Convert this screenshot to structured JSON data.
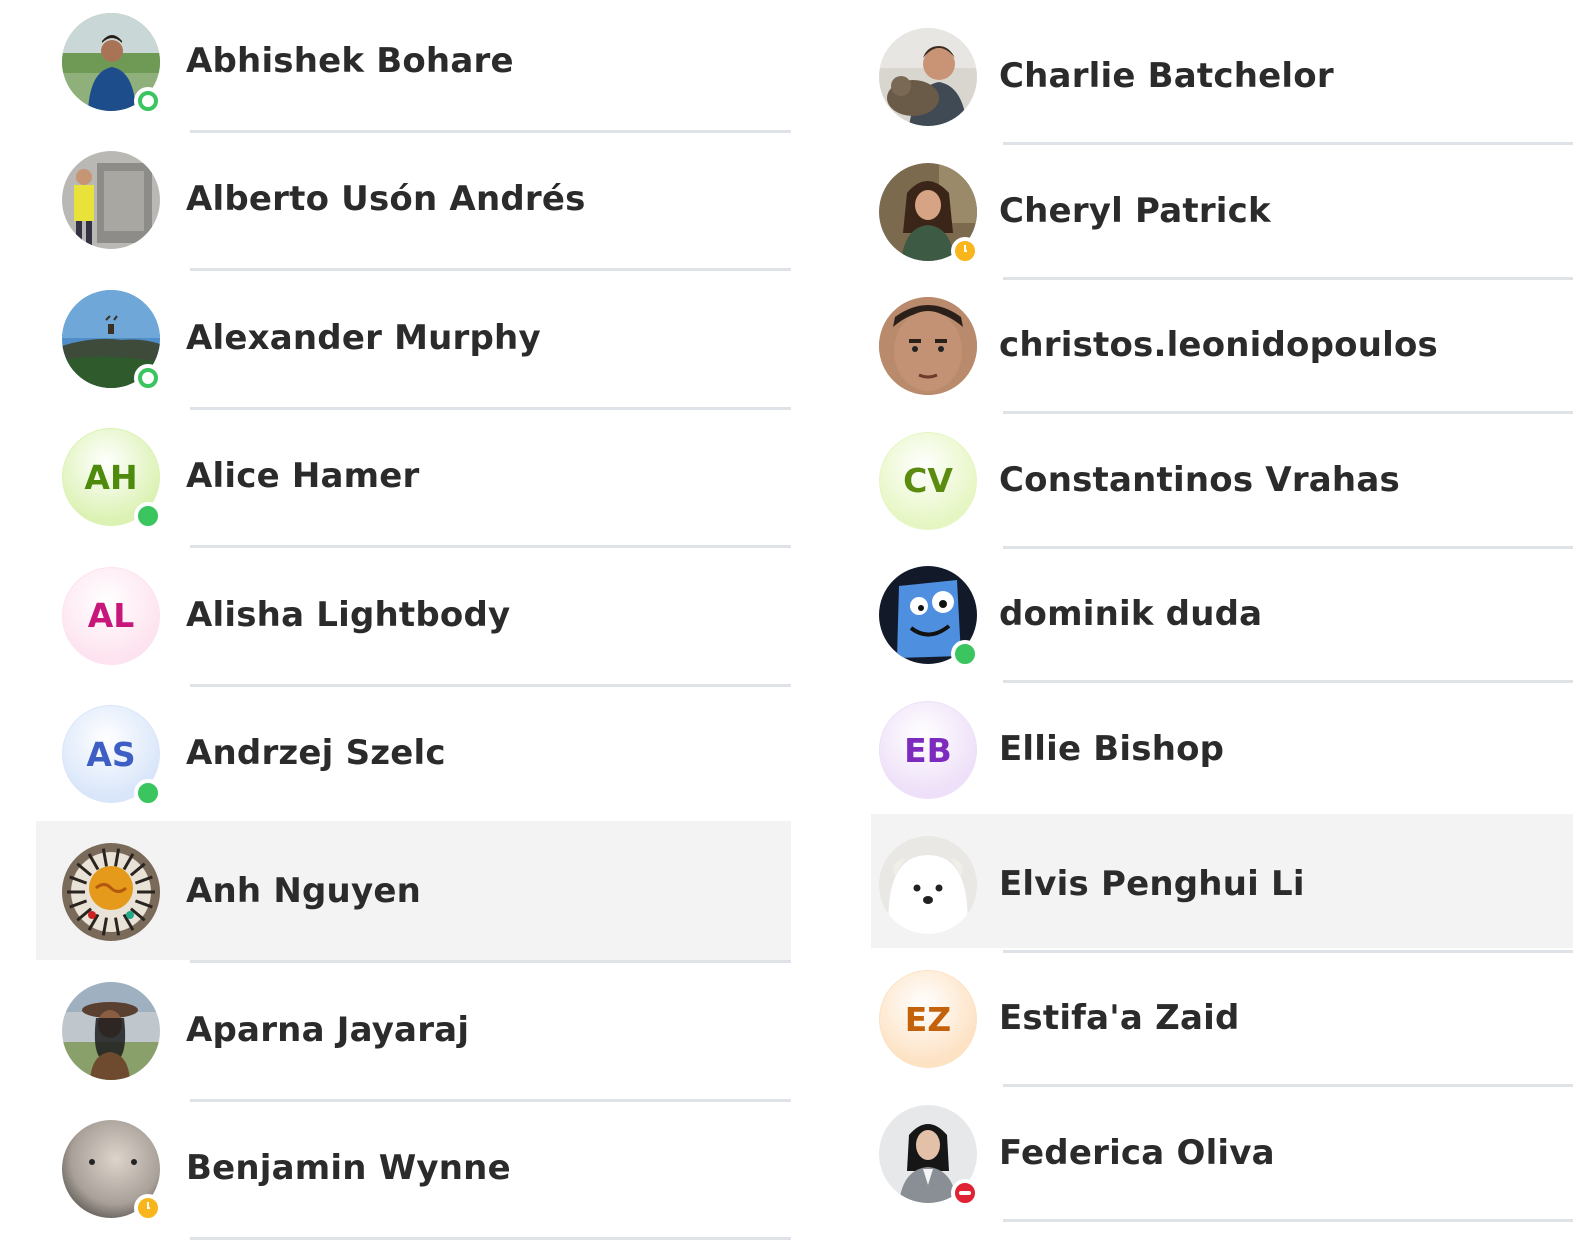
{
  "contacts_left": [
    {
      "name": "Abhishek Bohare",
      "avatar": "photo-man-blue-jacket",
      "status": "online-ring",
      "highlighted": false
    },
    {
      "name": "Alberto Usón Andrés",
      "avatar": "photo-man-with-machine",
      "status": "none",
      "highlighted": false
    },
    {
      "name": "Alexander Murphy",
      "avatar": "photo-deer-landscape",
      "status": "online-ring",
      "highlighted": false
    },
    {
      "name": "Alice Hamer",
      "avatar": "initials",
      "initials": "AH",
      "status": "online",
      "highlighted": false
    },
    {
      "name": "Alisha Lightbody",
      "avatar": "initials",
      "initials": "AL",
      "status": "none",
      "highlighted": false
    },
    {
      "name": "Andrzej Szelc",
      "avatar": "initials",
      "initials": "AS",
      "status": "online",
      "highlighted": false
    },
    {
      "name": "Anh Nguyen",
      "avatar": "photo-food-plate",
      "status": "none",
      "highlighted": true
    },
    {
      "name": "Aparna Jayaraj",
      "avatar": "photo-woman-hat",
      "status": "none",
      "highlighted": false
    },
    {
      "name": "Benjamin Wynne",
      "avatar": "photo-grey-blob",
      "status": "away",
      "highlighted": false
    }
  ],
  "contacts_right": [
    {
      "name": "Charlie Batchelor",
      "avatar": "photo-man-with-cat",
      "status": "none",
      "highlighted": false
    },
    {
      "name": "Cheryl Patrick",
      "avatar": "photo-woman-smiling",
      "status": "away",
      "highlighted": false
    },
    {
      "name": "christos.leonidopoulos",
      "avatar": "photo-man-face",
      "status": "none",
      "highlighted": false
    },
    {
      "name": "Constantinos Vrahas",
      "avatar": "initials",
      "initials": "CV",
      "status": "none",
      "highlighted": false
    },
    {
      "name": "dominik duda",
      "avatar": "photo-cartoon-face",
      "status": "online",
      "highlighted": false
    },
    {
      "name": "Ellie Bishop",
      "avatar": "initials",
      "initials": "EB",
      "status": "none",
      "highlighted": false
    },
    {
      "name": "Elvis Penghui Li",
      "avatar": "photo-white-dog",
      "status": "none",
      "highlighted": true
    },
    {
      "name": "Estifa'a Zaid",
      "avatar": "initials",
      "initials": "EZ",
      "status": "none",
      "highlighted": false
    },
    {
      "name": "Federica Oliva",
      "avatar": "photo-woman-portrait",
      "status": "dnd",
      "highlighted": false
    }
  ],
  "colors": {
    "online": "#3ac55f",
    "away": "#f8b51c",
    "dnd": "#e02235",
    "divider": "#dfe3e8",
    "highlight": "#f3f3f3",
    "AH": {
      "bg": "#dcf2b4",
      "fg": "#4e8a0c"
    },
    "AL": {
      "bg": "#fde3ef",
      "fg": "#c8177b"
    },
    "AS": {
      "bg": "#d9e6fa",
      "fg": "#3d5fc4"
    },
    "CV": {
      "bg": "#e6f6c3",
      "fg": "#5b8c10"
    },
    "EB": {
      "bg": "#eee0f8",
      "fg": "#7d2bbf"
    },
    "EZ": {
      "bg": "#fde2c4",
      "fg": "#c4620c"
    }
  }
}
